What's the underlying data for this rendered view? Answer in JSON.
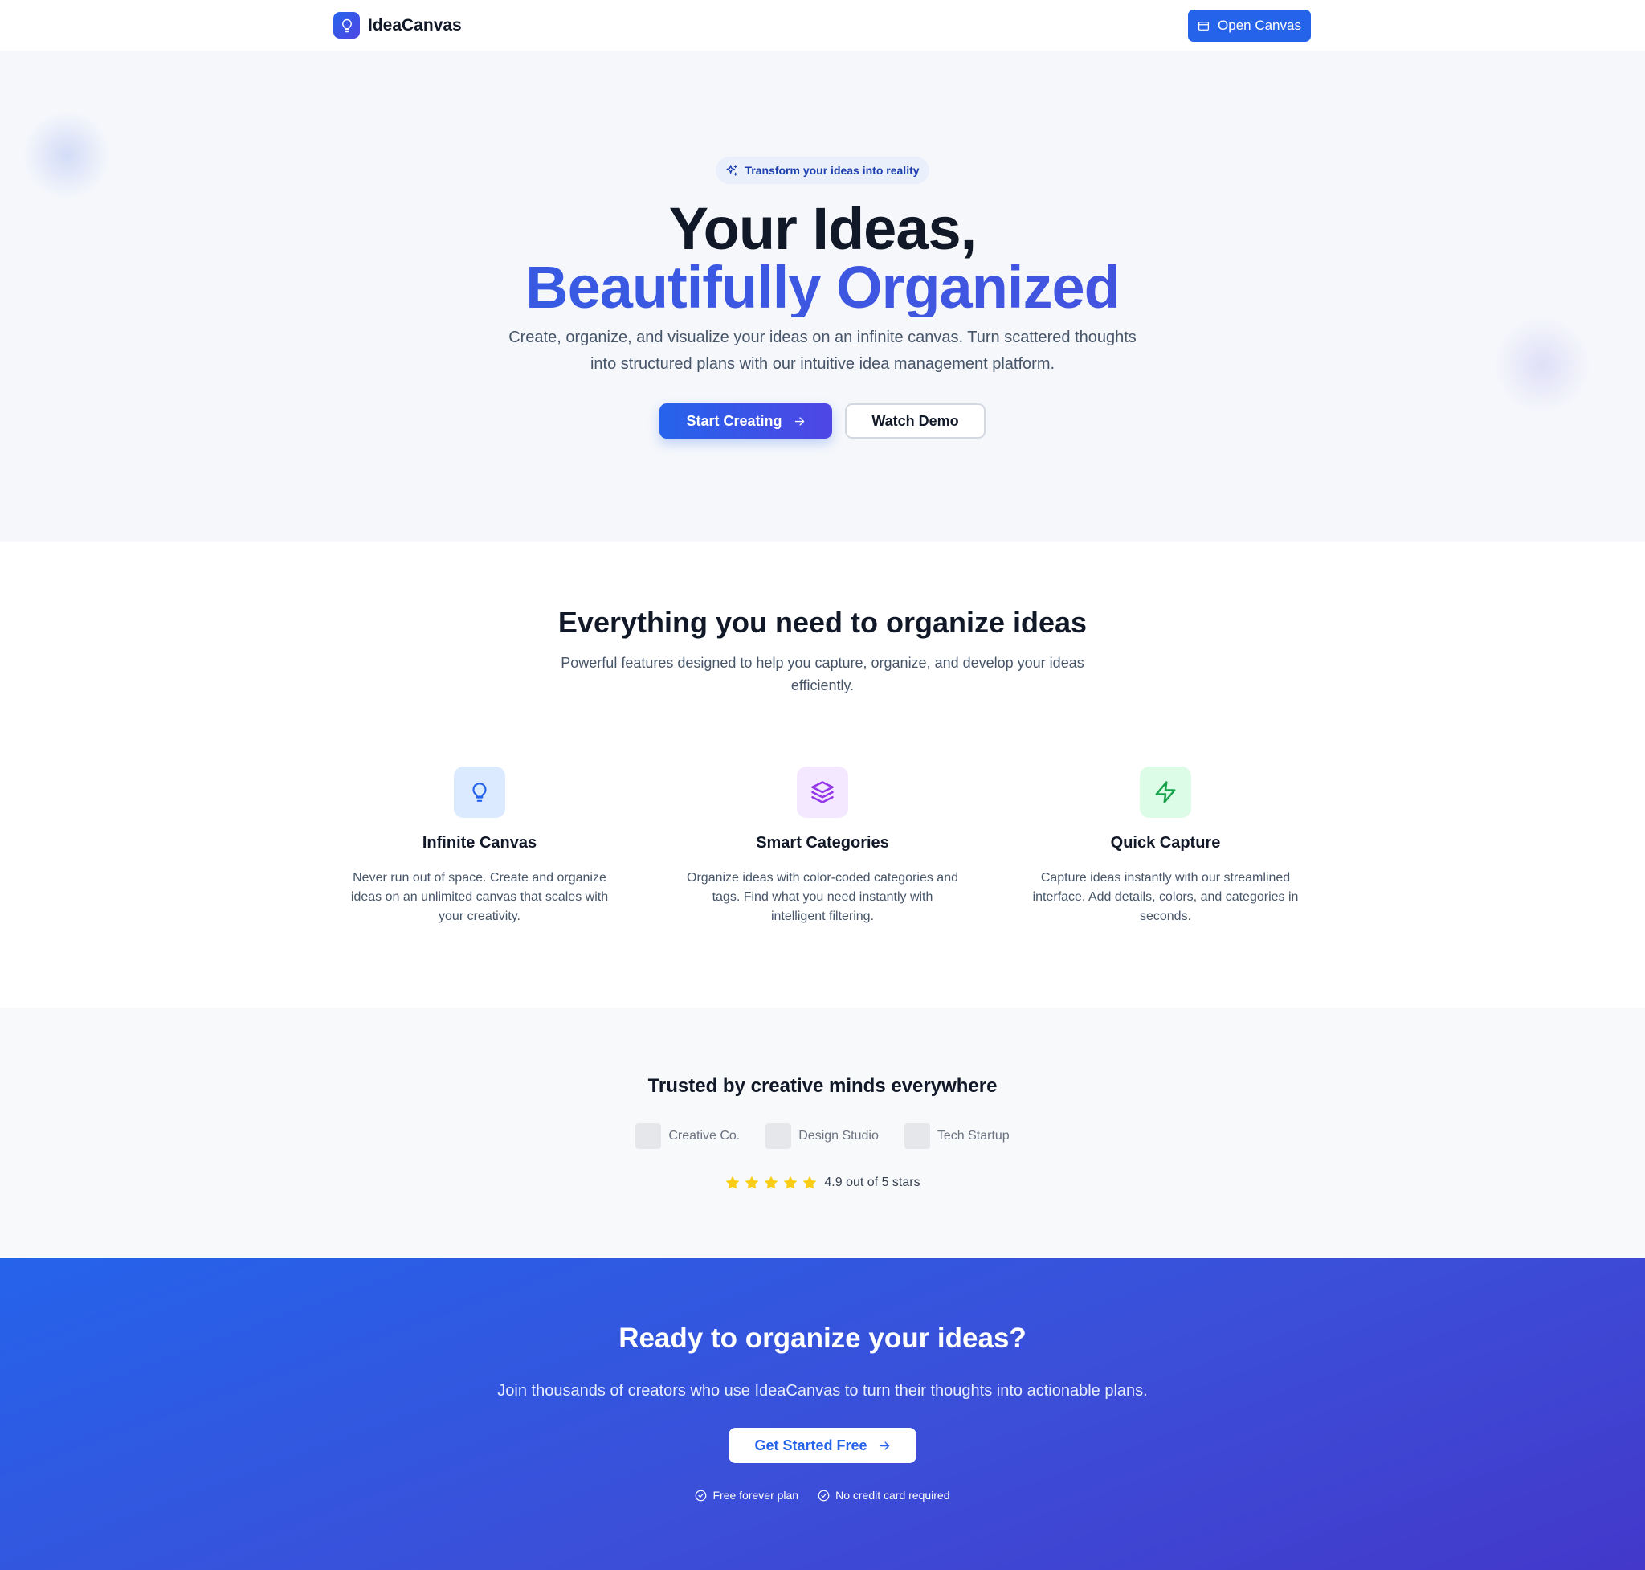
{
  "nav": {
    "brand": "IdeaCanvas",
    "logo_icon": "lightbulb-icon",
    "open_canvas_label": "Open Canvas",
    "open_canvas_icon": "window-icon"
  },
  "hero": {
    "badge": "Transform your ideas into reality",
    "badge_icon": "sparkles-icon",
    "title_line1": "Your Ideas,",
    "title_line2": "Beautifully Organized",
    "subtitle": "Create, organize, and visualize your ideas on an infinite canvas. Turn scattered thoughts into structured plans with our intuitive idea management platform.",
    "primary_cta": "Start Creating",
    "secondary_cta": "Watch Demo"
  },
  "features": {
    "title": "Everything you need to organize ideas",
    "subtitle": "Powerful features designed to help you capture, organize, and develop your ideas efficiently.",
    "items": [
      {
        "icon": "lightbulb-icon",
        "title": "Infinite Canvas",
        "description": "Never run out of space. Create and organize ideas on an unlimited canvas that scales with your creativity.",
        "bg": "#dbeafe",
        "color": "#2563eb"
      },
      {
        "icon": "layers-icon",
        "title": "Smart Categories",
        "description": "Organize ideas with color-coded categories and tags. Find what you need instantly with intelligent filtering.",
        "bg": "#f3e8ff",
        "color": "#9333ea"
      },
      {
        "icon": "lightning-icon",
        "title": "Quick Capture",
        "description": "Capture ideas instantly with our streamlined interface. Add details, colors, and categories in seconds.",
        "bg": "#dcfce7",
        "color": "#16a34a"
      }
    ]
  },
  "trusted": {
    "title": "Trusted by creative minds everywhere",
    "logos": [
      "Creative Co.",
      "Design Studio",
      "Tech Startup"
    ],
    "rating_text": "4.9 out of 5 stars",
    "stars": 5
  },
  "cta": {
    "title": "Ready to organize your ideas?",
    "subtitle": "Join thousands of creators who use IdeaCanvas to turn their thoughts into actionable plans.",
    "button": "Get Started Free",
    "perks": [
      "Free forever plan",
      "No credit card required"
    ]
  },
  "colors": {
    "primary": "#2563eb",
    "accent": "#4f46e5",
    "star": "#facc15"
  }
}
